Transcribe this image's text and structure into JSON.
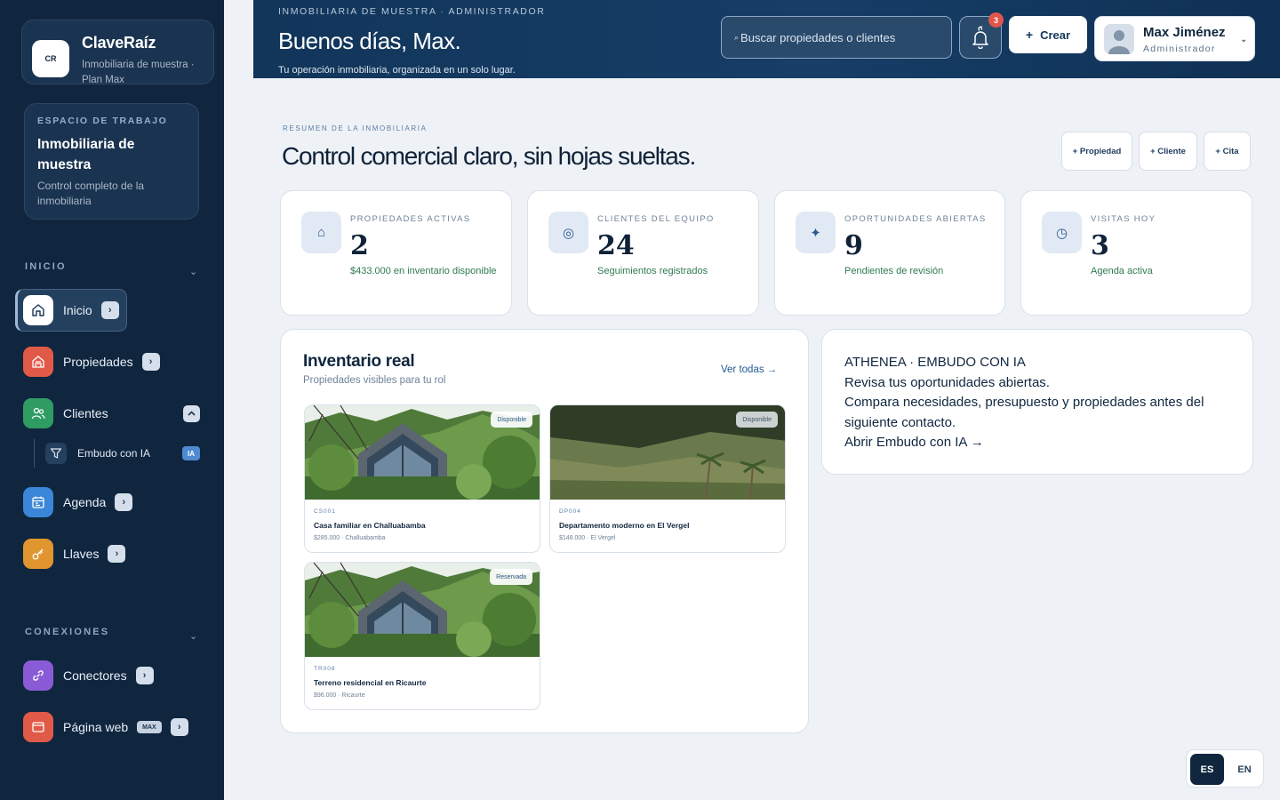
{
  "brand": {
    "logo": "CR",
    "name": "ClaveRaíz",
    "subtitle": "Inmobiliaria de muestra · Plan Max"
  },
  "workspace": {
    "label": "ESPACIO DE TRABAJO",
    "title": "Inmobiliaria de muestra",
    "subtitle": "Control completo de la inmobiliaria"
  },
  "sidebar": {
    "section_home": "INICIO",
    "section_connections": "CONEXIONES",
    "arrow_glyph": "›",
    "items": [
      {
        "label": "Inicio",
        "icon": "home-icon",
        "color": "#ffffff"
      },
      {
        "label": "Propiedades",
        "icon": "building-icon",
        "color": "#e05a47"
      },
      {
        "label": "Clientes",
        "icon": "users-icon",
        "color": "#2f9c63"
      },
      {
        "label": "Agenda",
        "icon": "calendar-icon",
        "color": "#3a86d8"
      },
      {
        "label": "Llaves",
        "icon": "key-icon",
        "color": "#e0952f"
      },
      {
        "label": "Conectores",
        "icon": "link-icon",
        "color": "#8a5bd6"
      },
      {
        "label": "Página web",
        "icon": "browser-icon",
        "color": "#e05a47",
        "badge": "MAX"
      }
    ],
    "subitem": {
      "label": "Embudo con IA",
      "icon": "funnel-icon",
      "badge": "IA"
    }
  },
  "header": {
    "kicker": "INMOBILIARIA DE MUESTRA · ADMINISTRADOR",
    "greeting": "Buenos días, Max.",
    "subtitle": "Tu operación inmobiliaria, organizada en un solo lugar.",
    "search_placeholder": "Buscar propiedades o clientes",
    "notifications_count": "3",
    "create_plus": "+",
    "create_label": "Crear",
    "user_name": "Max Jiménez",
    "user_role": "Administrador"
  },
  "main": {
    "kicker": "RESUMEN DE LA INMOBILIARIA",
    "title": "Control comercial claro, sin hojas sueltas.",
    "quick_actions": [
      "+ Propiedad",
      "+ Cliente",
      "+ Cita"
    ]
  },
  "stats": [
    {
      "label": "PROPIEDADES ACTIVAS",
      "value": "2",
      "note": "$433.000 en inventario disponible",
      "icon": "house-icon",
      "glyph": "⌂"
    },
    {
      "label": "CLIENTES DEL EQUIPO",
      "value": "24",
      "note": "Seguimientos registrados",
      "icon": "target-icon",
      "glyph": "◎"
    },
    {
      "label": "OPORTUNIDADES ABIERTAS",
      "value": "9",
      "note": "Pendientes de revisión",
      "icon": "sparkle-icon",
      "glyph": "✦"
    },
    {
      "label": "VISITAS HOY",
      "value": "3",
      "note": "Agenda activa",
      "icon": "clock-icon",
      "glyph": "◷"
    }
  ],
  "inventory": {
    "title": "Inventario real",
    "subtitle": "Propiedades visibles para tu rol",
    "view_all": "Ver todas →",
    "properties": [
      {
        "code": "CS001",
        "name": "Casa familiar en Challuabamba",
        "meta": "$285.000 · Challuabamba",
        "status": "Disponible",
        "image": "house-photo"
      },
      {
        "code": "DP004",
        "name": "Departamento moderno en El Vergel",
        "meta": "$148.000 · El Vergel",
        "status": "Disponible",
        "image": "hillside-photo"
      },
      {
        "code": "TR008",
        "name": "Terreno residencial en Ricaurte",
        "meta": "$96.000 · Ricaurte",
        "status": "Reservada",
        "image": "house-photo"
      }
    ]
  },
  "ai_card": {
    "line1": "ATHENEA · EMBUDO CON IA",
    "line2": "Revisa tus oportunidades abiertas.",
    "line3": "Compara necesidades, presupuesto y propiedades antes del siguiente contacto.",
    "link": "Abrir Embudo con IA →"
  },
  "language": {
    "es": "ES",
    "en": "EN",
    "active": "ES"
  }
}
